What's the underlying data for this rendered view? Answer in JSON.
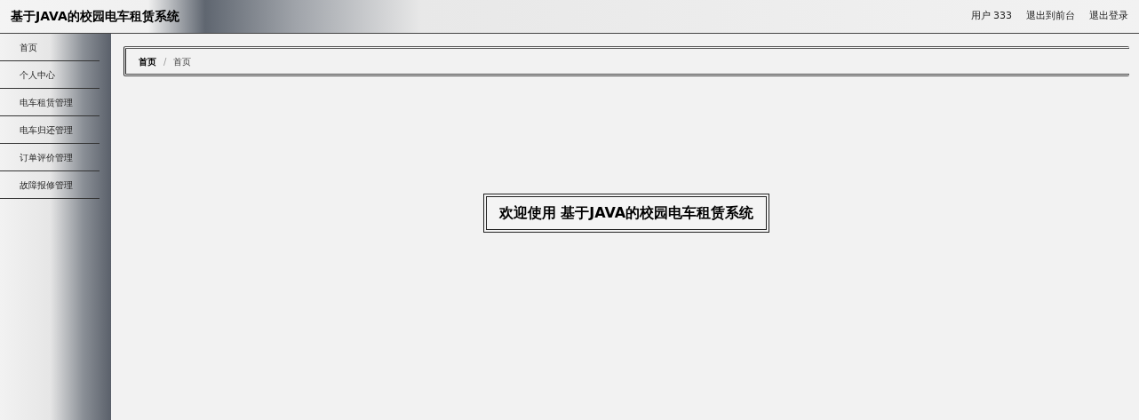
{
  "header": {
    "title": "基于JAVA的校园电车租赁系统",
    "links": [
      "用户 333",
      "退出到前台",
      "退出登录"
    ]
  },
  "sidebar": {
    "items": [
      "首页",
      "个人中心",
      "电车租赁管理",
      "电车归还管理",
      "订单评价管理",
      "故障报修管理"
    ]
  },
  "breadcrumb": {
    "items": [
      "首页",
      "首页"
    ],
    "separator": "/"
  },
  "welcome": "欢迎使用 基于JAVA的校园电车租赁系统"
}
